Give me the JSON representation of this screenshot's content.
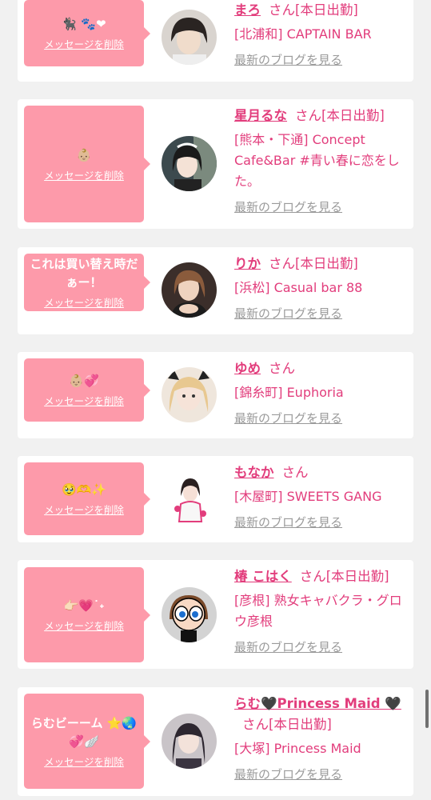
{
  "delete_label": "メッセージを削除",
  "blog_label": "最新のブログを見る",
  "san_label": "さん",
  "entries": [
    {
      "message": "🐈‍⬛ 🐾❤",
      "name": "まろ",
      "status": "[本日出勤]",
      "shop": "[北浦和] CAPTAIN BAR"
    },
    {
      "message": "👶🏼",
      "name": "星月るな",
      "status": "[本日出勤]",
      "shop": "[熊本・下通] Concept Cafe&Bar #青い春に恋をした。"
    },
    {
      "message": "これは買い替え時だぁー！",
      "name": "りか",
      "status": "[本日出勤]",
      "shop": "[浜松] Casual bar 88"
    },
    {
      "message": "👶🏼💞",
      "name": "ゆめ",
      "status": "",
      "shop": "[錦糸町] Euphoria"
    },
    {
      "message": "🥹🫶✨",
      "name": "もなか",
      "status": "",
      "shop": "[木屋町] SWEETS GANG"
    },
    {
      "message": "👉🏻💗˙˖",
      "name": "椿 こはく",
      "status": "[本日出勤]",
      "shop": "[彦根] 熟女キャバクラ・グロウ彦根"
    },
    {
      "message": "らむビーーム ⭐️🌏💞🪽",
      "name": "らむ🖤Princess Maid 🖤",
      "status": "[本日出勤]",
      "shop": "[大塚] Princess Maid"
    }
  ]
}
